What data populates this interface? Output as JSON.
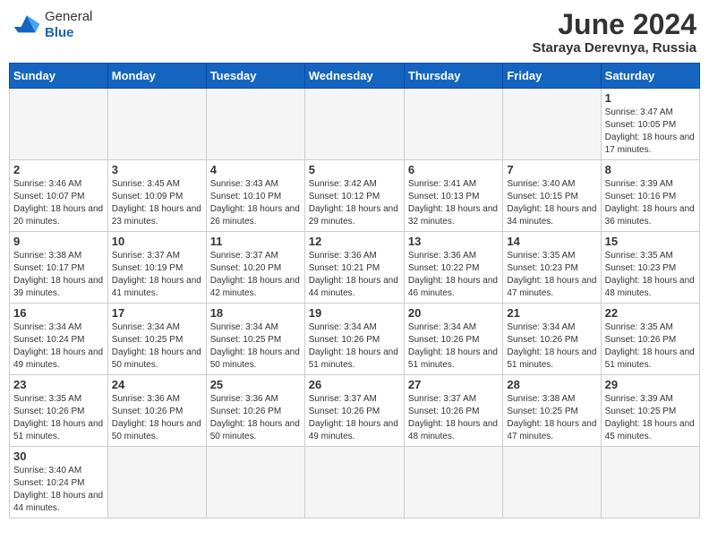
{
  "header": {
    "logo_general": "General",
    "logo_blue": "Blue",
    "month_title": "June 2024",
    "subtitle": "Staraya Derevnya, Russia"
  },
  "weekdays": [
    "Sunday",
    "Monday",
    "Tuesday",
    "Wednesday",
    "Thursday",
    "Friday",
    "Saturday"
  ],
  "weeks": [
    [
      {
        "day": "",
        "info": ""
      },
      {
        "day": "",
        "info": ""
      },
      {
        "day": "",
        "info": ""
      },
      {
        "day": "",
        "info": ""
      },
      {
        "day": "",
        "info": ""
      },
      {
        "day": "",
        "info": ""
      },
      {
        "day": "1",
        "info": "Sunrise: 3:47 AM\nSunset: 10:05 PM\nDaylight: 18 hours and 17 minutes."
      }
    ],
    [
      {
        "day": "2",
        "info": "Sunrise: 3:46 AM\nSunset: 10:07 PM\nDaylight: 18 hours and 20 minutes."
      },
      {
        "day": "3",
        "info": "Sunrise: 3:45 AM\nSunset: 10:09 PM\nDaylight: 18 hours and 23 minutes."
      },
      {
        "day": "4",
        "info": "Sunrise: 3:43 AM\nSunset: 10:10 PM\nDaylight: 18 hours and 26 minutes."
      },
      {
        "day": "5",
        "info": "Sunrise: 3:42 AM\nSunset: 10:12 PM\nDaylight: 18 hours and 29 minutes."
      },
      {
        "day": "6",
        "info": "Sunrise: 3:41 AM\nSunset: 10:13 PM\nDaylight: 18 hours and 32 minutes."
      },
      {
        "day": "7",
        "info": "Sunrise: 3:40 AM\nSunset: 10:15 PM\nDaylight: 18 hours and 34 minutes."
      },
      {
        "day": "8",
        "info": "Sunrise: 3:39 AM\nSunset: 10:16 PM\nDaylight: 18 hours and 36 minutes."
      }
    ],
    [
      {
        "day": "9",
        "info": "Sunrise: 3:38 AM\nSunset: 10:17 PM\nDaylight: 18 hours and 39 minutes."
      },
      {
        "day": "10",
        "info": "Sunrise: 3:37 AM\nSunset: 10:19 PM\nDaylight: 18 hours and 41 minutes."
      },
      {
        "day": "11",
        "info": "Sunrise: 3:37 AM\nSunset: 10:20 PM\nDaylight: 18 hours and 42 minutes."
      },
      {
        "day": "12",
        "info": "Sunrise: 3:36 AM\nSunset: 10:21 PM\nDaylight: 18 hours and 44 minutes."
      },
      {
        "day": "13",
        "info": "Sunrise: 3:36 AM\nSunset: 10:22 PM\nDaylight: 18 hours and 46 minutes."
      },
      {
        "day": "14",
        "info": "Sunrise: 3:35 AM\nSunset: 10:23 PM\nDaylight: 18 hours and 47 minutes."
      },
      {
        "day": "15",
        "info": "Sunrise: 3:35 AM\nSunset: 10:23 PM\nDaylight: 18 hours and 48 minutes."
      }
    ],
    [
      {
        "day": "16",
        "info": "Sunrise: 3:34 AM\nSunset: 10:24 PM\nDaylight: 18 hours and 49 minutes."
      },
      {
        "day": "17",
        "info": "Sunrise: 3:34 AM\nSunset: 10:25 PM\nDaylight: 18 hours and 50 minutes."
      },
      {
        "day": "18",
        "info": "Sunrise: 3:34 AM\nSunset: 10:25 PM\nDaylight: 18 hours and 50 minutes."
      },
      {
        "day": "19",
        "info": "Sunrise: 3:34 AM\nSunset: 10:26 PM\nDaylight: 18 hours and 51 minutes."
      },
      {
        "day": "20",
        "info": "Sunrise: 3:34 AM\nSunset: 10:26 PM\nDaylight: 18 hours and 51 minutes."
      },
      {
        "day": "21",
        "info": "Sunrise: 3:34 AM\nSunset: 10:26 PM\nDaylight: 18 hours and 51 minutes."
      },
      {
        "day": "22",
        "info": "Sunrise: 3:35 AM\nSunset: 10:26 PM\nDaylight: 18 hours and 51 minutes."
      }
    ],
    [
      {
        "day": "23",
        "info": "Sunrise: 3:35 AM\nSunset: 10:26 PM\nDaylight: 18 hours and 51 minutes."
      },
      {
        "day": "24",
        "info": "Sunrise: 3:36 AM\nSunset: 10:26 PM\nDaylight: 18 hours and 50 minutes."
      },
      {
        "day": "25",
        "info": "Sunrise: 3:36 AM\nSunset: 10:26 PM\nDaylight: 18 hours and 50 minutes."
      },
      {
        "day": "26",
        "info": "Sunrise: 3:37 AM\nSunset: 10:26 PM\nDaylight: 18 hours and 49 minutes."
      },
      {
        "day": "27",
        "info": "Sunrise: 3:37 AM\nSunset: 10:26 PM\nDaylight: 18 hours and 48 minutes."
      },
      {
        "day": "28",
        "info": "Sunrise: 3:38 AM\nSunset: 10:25 PM\nDaylight: 18 hours and 47 minutes."
      },
      {
        "day": "29",
        "info": "Sunrise: 3:39 AM\nSunset: 10:25 PM\nDaylight: 18 hours and 45 minutes."
      }
    ],
    [
      {
        "day": "30",
        "info": "Sunrise: 3:40 AM\nSunset: 10:24 PM\nDaylight: 18 hours and 44 minutes."
      },
      {
        "day": "",
        "info": ""
      },
      {
        "day": "",
        "info": ""
      },
      {
        "day": "",
        "info": ""
      },
      {
        "day": "",
        "info": ""
      },
      {
        "day": "",
        "info": ""
      },
      {
        "day": "",
        "info": ""
      }
    ]
  ]
}
